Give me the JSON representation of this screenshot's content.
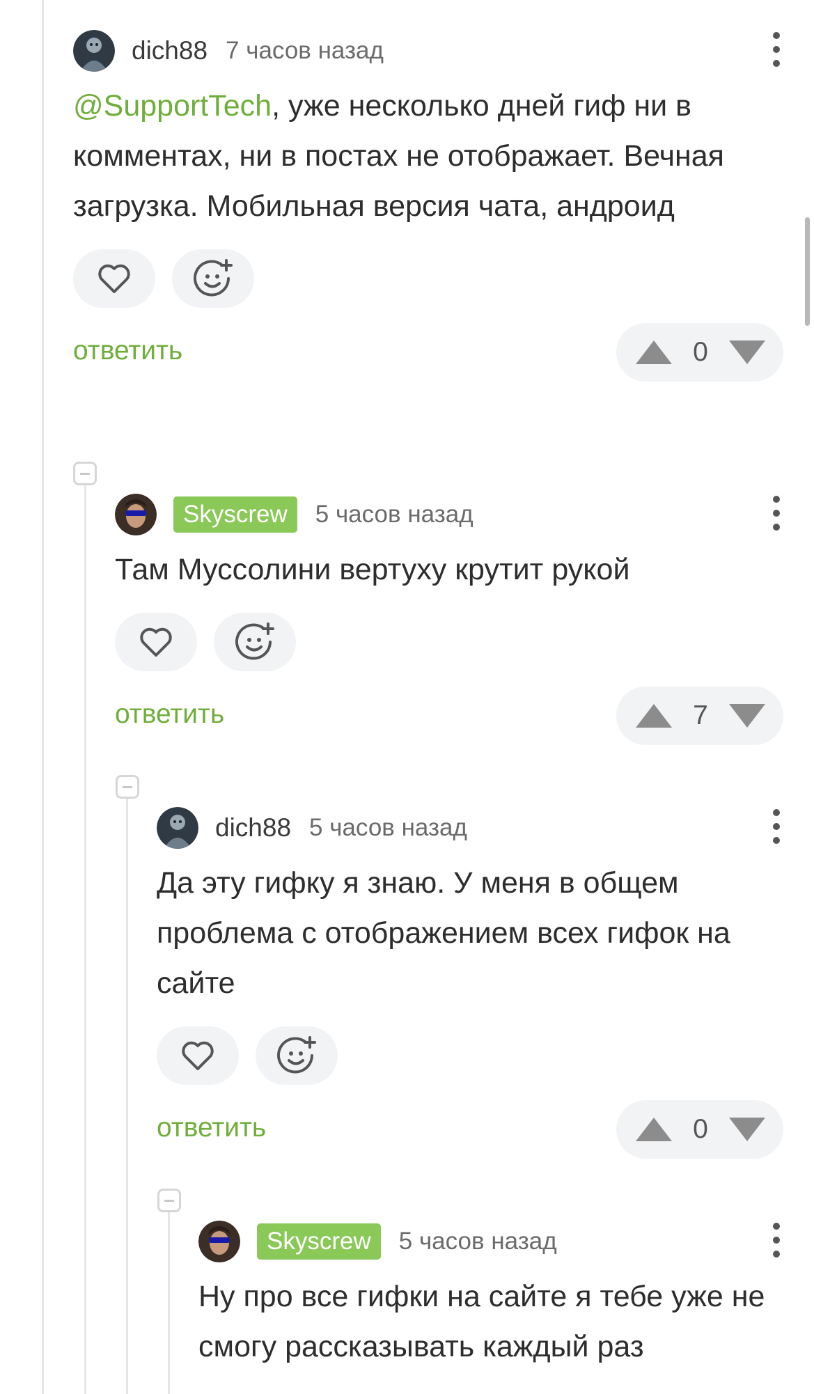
{
  "comments": [
    {
      "author": "dich88",
      "time": "7 часов назад",
      "mention": "@SupportTech",
      "text": ", уже несколько дней гиф ни в комментах, ни в постах не отображает. Вечная загрузка. Мобильная версия чата, андроид",
      "reply_label": "ответить",
      "rating": "0"
    },
    {
      "author": "Skyscrew",
      "time": "5 часов назад",
      "text": "Там Муссолини вертуху крутит рукой",
      "reply_label": "ответить",
      "rating": "7"
    },
    {
      "author": "dich88",
      "time": "5 часов назад",
      "text": "Да эту гифку я знаю. У меня в общем проблема с отображением всех гифок на сайте",
      "reply_label": "ответить",
      "rating": "0"
    },
    {
      "author": "Skyscrew",
      "time": "5 часов назад",
      "text": "Ну про все гифки на сайте я тебе уже не смогу рассказывать каждый раз"
    }
  ],
  "colors": {
    "accent": "#6fae3b",
    "badge": "#8ac858",
    "pill_bg": "#f2f3f5"
  },
  "icons": [
    "heart-icon",
    "add-reaction-icon",
    "more-icon",
    "upvote-icon",
    "downvote-icon",
    "collapse-icon"
  ]
}
